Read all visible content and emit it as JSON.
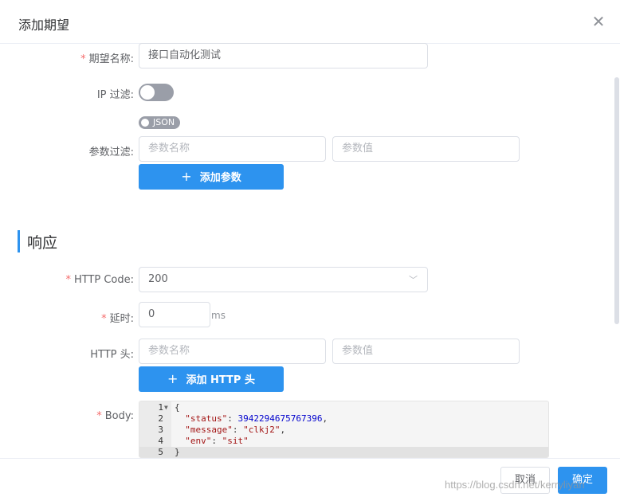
{
  "dialog": {
    "title": "添加期望",
    "close_icon": "close-icon"
  },
  "form": {
    "expectation_name": {
      "label": "期望名称:",
      "required": true,
      "value": "接口自动化测试"
    },
    "ip_filter": {
      "label": "IP 过滤:",
      "enabled": false
    },
    "json_toggle": {
      "label": "JSON",
      "enabled": false
    },
    "param_filter": {
      "label": "参数过滤:",
      "name_placeholder": "参数名称",
      "value_placeholder": "参数值",
      "add_button": "添加参数"
    }
  },
  "response_section": {
    "title": "响应",
    "http_code": {
      "label": "HTTP Code:",
      "required": true,
      "value": "200"
    },
    "delay": {
      "label": "延时:",
      "required": true,
      "value": "0",
      "unit": "ms"
    },
    "http_header": {
      "label": "HTTP 头:",
      "name_placeholder": "参数名称",
      "value_placeholder": "参数值",
      "add_button": "添加 HTTP 头"
    },
    "body": {
      "label": "Body:",
      "required": true,
      "lines": [
        {
          "num": "1",
          "text": "{"
        },
        {
          "num": "2",
          "key": "\"status\"",
          "value": "3942294675767396",
          "sep": ": ",
          "tail": ","
        },
        {
          "num": "3",
          "key": "\"message\"",
          "value": "\"clkj2\"",
          "sep": ": ",
          "tail": ","
        },
        {
          "num": "4",
          "key": "\"env\"",
          "value": "\"sit\"",
          "sep": ": ",
          "tail": ""
        },
        {
          "num": "5",
          "text": "}"
        }
      ]
    }
  },
  "footer": {
    "cancel": "取消",
    "confirm": "确定"
  },
  "watermark": "https://blog.csdn.net/kerryliyan",
  "colors": {
    "primary": "#2d93ef",
    "required": "#f56c6c",
    "switch_off": "#9a9ea8"
  }
}
